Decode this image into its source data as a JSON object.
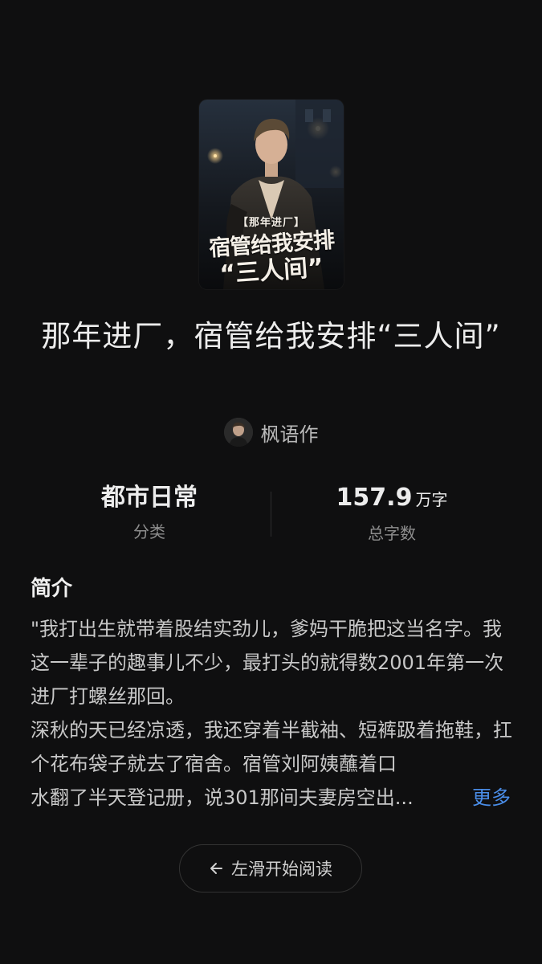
{
  "book": {
    "cover": {
      "tag_text": "【那年进厂】",
      "main_text": "宿管给我安排",
      "sub_text": "“三人间”"
    },
    "title": "那年进厂，宿管给我安排“三人间”",
    "author": "枫语作",
    "stats": {
      "category_value": "都市日常",
      "category_label": "分类",
      "word_count_value": "157.9",
      "word_count_unit": "万字",
      "word_count_label": "总字数"
    },
    "intro": {
      "heading": "简介",
      "paragraph1": "\"我打出生就带着股结实劲儿，爹妈干脆把这当名字。我这一辈子的趣事儿不少，最打头的就得数2001年第一次进厂打螺丝那回。",
      "paragraph2_lead": "深秋的天已经凉透，我还穿着半截袖、短裤趿着拖鞋，扛个花布袋子就去了宿舍。宿管刘阿姨蘸着口",
      "paragraph2_tail": "水翻了半天登记册，说301那间夫妻房空出...",
      "more_label": "更多"
    },
    "start_button_label": "左滑开始阅读"
  },
  "colors": {
    "background": "#0f0f10",
    "accent_link": "#4a8de8"
  },
  "icons": {
    "start_button": "arrow-left-icon"
  }
}
